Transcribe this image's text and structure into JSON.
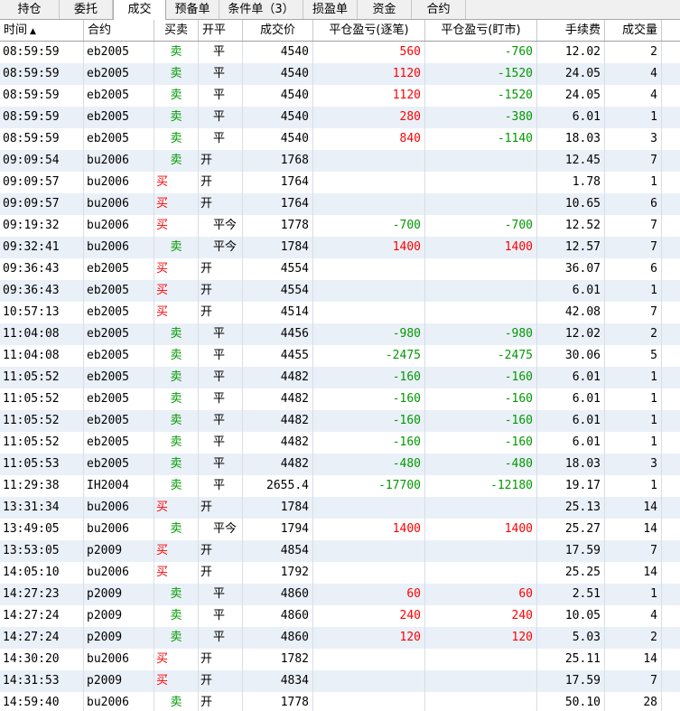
{
  "tabs": [
    {
      "label": "持仓",
      "w": 66
    },
    {
      "label": "委托",
      "w": 59
    },
    {
      "label": "成交",
      "w": 59,
      "active": true
    },
    {
      "label": "预备单",
      "w": 59
    },
    {
      "label": "条件单（3）",
      "w": 93
    },
    {
      "label": "损盈单",
      "w": 60
    },
    {
      "label": "资金",
      "w": 60
    },
    {
      "label": "合约",
      "w": 60
    }
  ],
  "columns": [
    "时间",
    "合约",
    "买卖",
    "开平",
    "成交价",
    "平仓盈亏(逐笔)",
    "平仓盈亏(盯市)",
    "手续费",
    "成交量"
  ],
  "sort_arrow": "▲",
  "colors": {
    "buy": "#ff0000",
    "sell": "#009900",
    "profit": "#ff0000",
    "loss": "#009900",
    "alt_row": "#eaf0f8"
  },
  "rows": [
    [
      "08:59:59",
      "eb2005",
      "卖",
      "平",
      "4540",
      "560",
      "-760",
      "12.02",
      "2"
    ],
    [
      "08:59:59",
      "eb2005",
      "卖",
      "平",
      "4540",
      "1120",
      "-1520",
      "24.05",
      "4"
    ],
    [
      "08:59:59",
      "eb2005",
      "卖",
      "平",
      "4540",
      "1120",
      "-1520",
      "24.05",
      "4"
    ],
    [
      "08:59:59",
      "eb2005",
      "卖",
      "平",
      "4540",
      "280",
      "-380",
      "6.01",
      "1"
    ],
    [
      "08:59:59",
      "eb2005",
      "卖",
      "平",
      "4540",
      "840",
      "-1140",
      "18.03",
      "3"
    ],
    [
      "09:09:54",
      "bu2006",
      "卖",
      "开",
      "1768",
      "",
      "",
      "12.45",
      "7"
    ],
    [
      "09:09:57",
      "bu2006",
      "买",
      "开",
      "1764",
      "",
      "",
      "1.78",
      "1"
    ],
    [
      "09:09:57",
      "bu2006",
      "买",
      "开",
      "1764",
      "",
      "",
      "10.65",
      "6"
    ],
    [
      "09:19:32",
      "bu2006",
      "买",
      "平今",
      "1778",
      "-700",
      "-700",
      "12.52",
      "7"
    ],
    [
      "09:32:41",
      "bu2006",
      "卖",
      "平今",
      "1784",
      "1400",
      "1400",
      "12.57",
      "7"
    ],
    [
      "09:36:43",
      "eb2005",
      "买",
      "开",
      "4554",
      "",
      "",
      "36.07",
      "6"
    ],
    [
      "09:36:43",
      "eb2005",
      "买",
      "开",
      "4554",
      "",
      "",
      "6.01",
      "1"
    ],
    [
      "10:57:13",
      "eb2005",
      "买",
      "开",
      "4514",
      "",
      "",
      "42.08",
      "7"
    ],
    [
      "11:04:08",
      "eb2005",
      "卖",
      "平",
      "4456",
      "-980",
      "-980",
      "12.02",
      "2"
    ],
    [
      "11:04:08",
      "eb2005",
      "卖",
      "平",
      "4455",
      "-2475",
      "-2475",
      "30.06",
      "5"
    ],
    [
      "11:05:52",
      "eb2005",
      "卖",
      "平",
      "4482",
      "-160",
      "-160",
      "6.01",
      "1"
    ],
    [
      "11:05:52",
      "eb2005",
      "卖",
      "平",
      "4482",
      "-160",
      "-160",
      "6.01",
      "1"
    ],
    [
      "11:05:52",
      "eb2005",
      "卖",
      "平",
      "4482",
      "-160",
      "-160",
      "6.01",
      "1"
    ],
    [
      "11:05:52",
      "eb2005",
      "卖",
      "平",
      "4482",
      "-160",
      "-160",
      "6.01",
      "1"
    ],
    [
      "11:05:53",
      "eb2005",
      "卖",
      "平",
      "4482",
      "-480",
      "-480",
      "18.03",
      "3"
    ],
    [
      "11:29:38",
      "IH2004",
      "卖",
      "平",
      "2655.4",
      "-17700",
      "-12180",
      "19.17",
      "1"
    ],
    [
      "13:31:34",
      "bu2006",
      "买",
      "开",
      "1784",
      "",
      "",
      "25.13",
      "14"
    ],
    [
      "13:49:05",
      "bu2006",
      "卖",
      "平今",
      "1794",
      "1400",
      "1400",
      "25.27",
      "14"
    ],
    [
      "13:53:05",
      "p2009",
      "买",
      "开",
      "4854",
      "",
      "",
      "17.59",
      "7"
    ],
    [
      "14:05:10",
      "bu2006",
      "买",
      "开",
      "1792",
      "",
      "",
      "25.25",
      "14"
    ],
    [
      "14:27:23",
      "p2009",
      "卖",
      "平",
      "4860",
      "60",
      "60",
      "2.51",
      "1"
    ],
    [
      "14:27:24",
      "p2009",
      "卖",
      "平",
      "4860",
      "240",
      "240",
      "10.05",
      "4"
    ],
    [
      "14:27:24",
      "p2009",
      "卖",
      "平",
      "4860",
      "120",
      "120",
      "5.03",
      "2"
    ],
    [
      "14:30:20",
      "bu2006",
      "买",
      "开",
      "1782",
      "",
      "",
      "25.11",
      "14"
    ],
    [
      "14:31:53",
      "p2009",
      "买",
      "开",
      "4834",
      "",
      "",
      "17.59",
      "7"
    ],
    [
      "14:59:40",
      "bu2006",
      "卖",
      "开",
      "1778",
      "",
      "",
      "50.10",
      "28"
    ]
  ]
}
